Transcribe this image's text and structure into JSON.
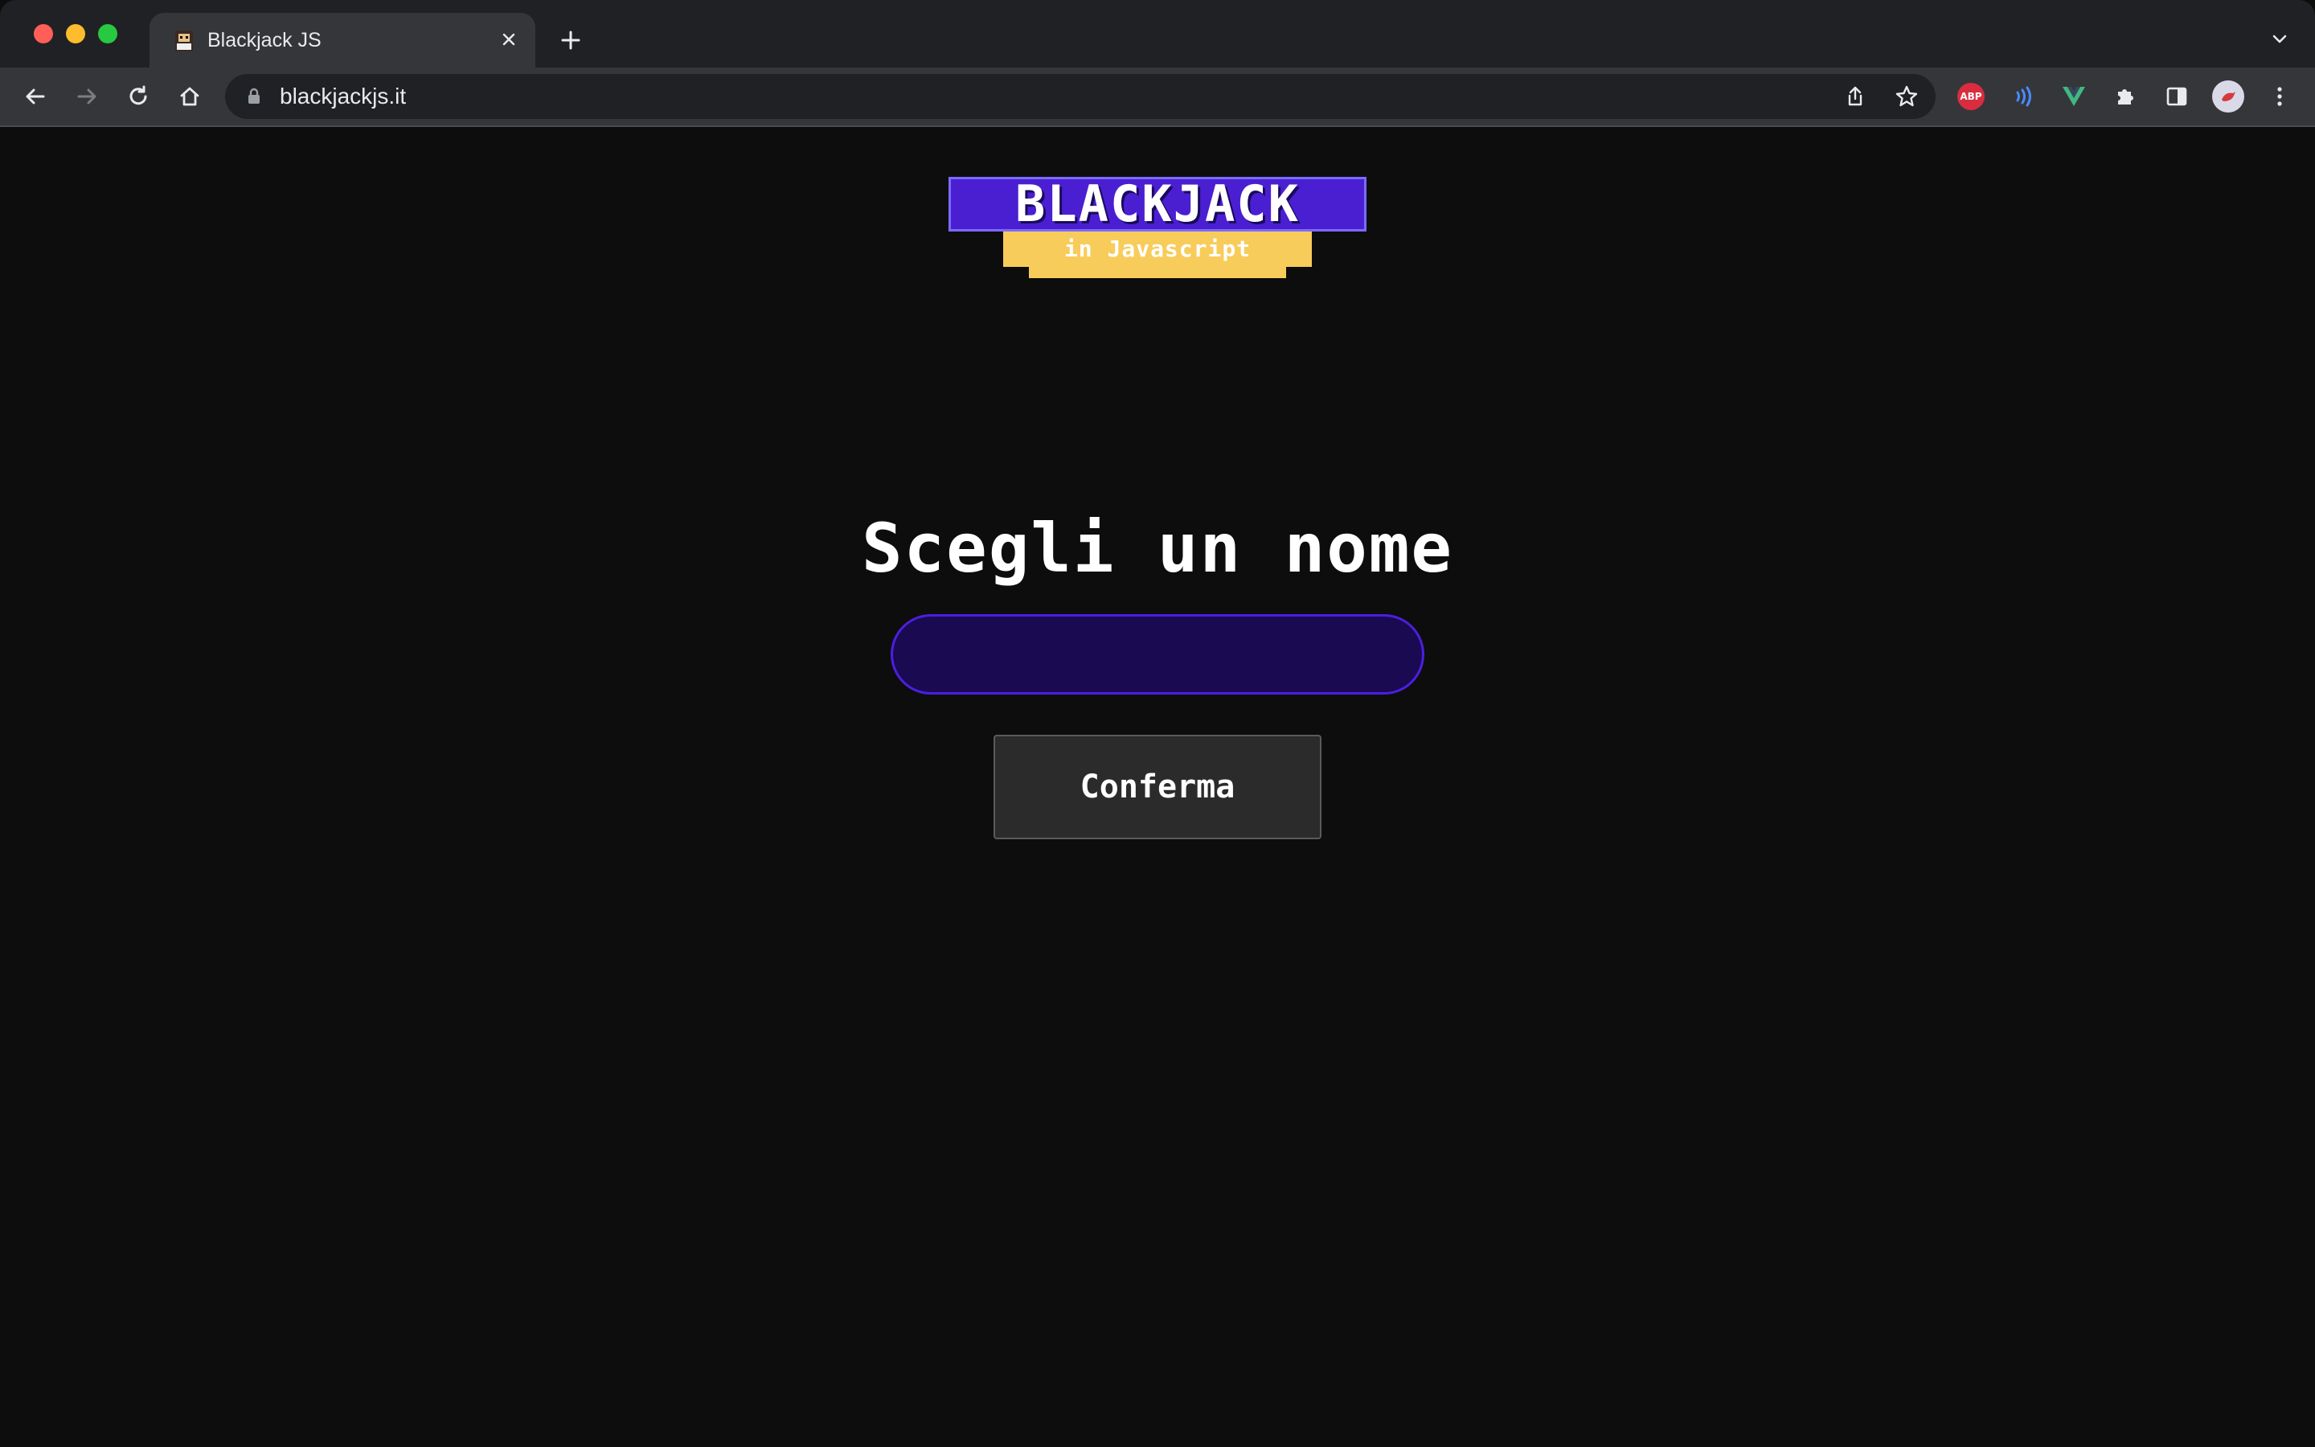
{
  "browser": {
    "tab": {
      "title": "Blackjack JS"
    },
    "address_bar": {
      "url": "blackjackjs.it"
    },
    "extensions": {
      "abp_label": "ABP"
    }
  },
  "page": {
    "logo": {
      "word": "BLACKJACK",
      "subtitle": "in Javascript"
    },
    "heading": "Scegli un nome",
    "name_input": {
      "value": "",
      "placeholder": ""
    },
    "confirm_label": "Conferma"
  },
  "colors": {
    "page_background": "#0d0d0d",
    "input_background": "#1a0a52",
    "input_border": "#4b1fe0",
    "button_background": "#2b2b2b",
    "logo_purple": "#4a1fd1",
    "logo_banner": "#f8cc5a"
  }
}
